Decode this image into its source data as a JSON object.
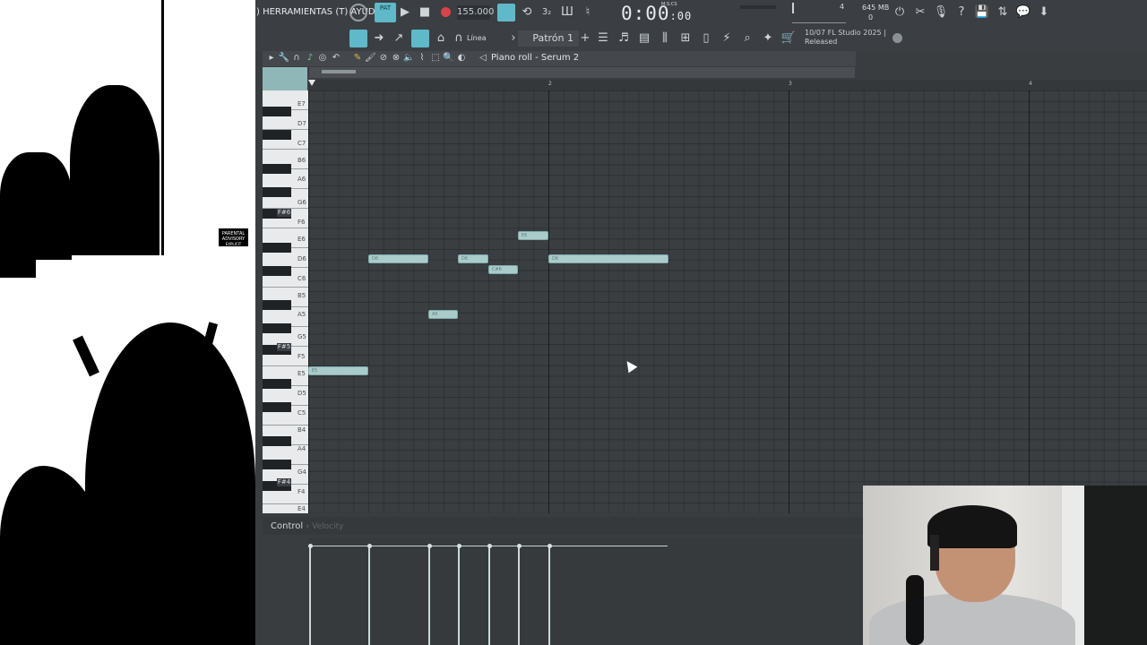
{
  "menu": {
    "text": ") HERRAMIENTAS (T) AYUDA"
  },
  "transport": {
    "pat_label": "PAT",
    "bpm": "155.000",
    "time_main": "0:00",
    "time_small": ":00",
    "time_unit": "M:S:CS"
  },
  "stats": {
    "cpu_num": "4",
    "memory": "645 MB",
    "voices": "0"
  },
  "toolbar2": {
    "snap_label": "Línea",
    "pattern": "Patrón 1",
    "news_line1": "10/07  FL Studio 2025 |",
    "news_line2": "Released"
  },
  "piano_roll": {
    "title": "Piano roll - Serum 2",
    "ruler": [
      "2",
      "3",
      "4"
    ],
    "control_label": "Control",
    "control_sub": "Velocity"
  },
  "keys": {
    "labels": [
      "E7",
      "D7",
      "C7",
      "B6",
      "A6",
      "G6",
      "F#6",
      "F6",
      "E6",
      "D6",
      "C6",
      "B5",
      "A5",
      "G5",
      "F#5",
      "F5",
      "E5",
      "D5",
      "C5",
      "B4",
      "A4",
      "G4",
      "F#4",
      "F4",
      "E4"
    ]
  },
  "notes": [
    {
      "label": "E5"
    },
    {
      "label": "D6"
    },
    {
      "label": "A5"
    },
    {
      "label": "D6"
    },
    {
      "label": "C#6"
    },
    {
      "label": "E6"
    },
    {
      "label": "D6"
    }
  ],
  "advisory": {
    "line1": "PARENTAL",
    "line2": "ADVISORY",
    "line3": "EXPLICIT CONTENT"
  },
  "colors": {
    "note": "#a9cccb",
    "bg": "#3a3e41",
    "accent": "#5fb9c9"
  }
}
